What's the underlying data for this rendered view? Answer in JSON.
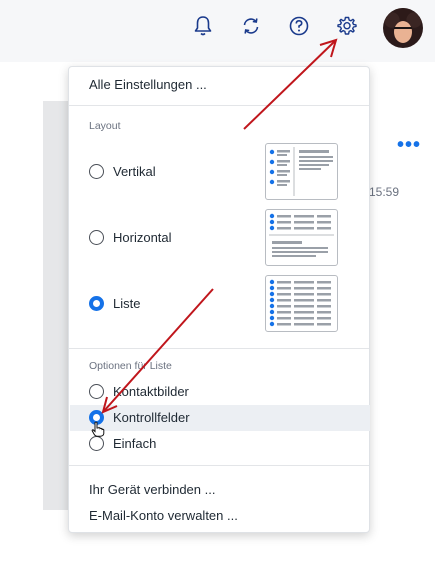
{
  "topbar": {
    "icons": [
      "bell-icon",
      "sync-icon",
      "help-icon",
      "gear-icon"
    ],
    "avatar": "avatar"
  },
  "background": {
    "more_dots": "•••",
    "time": "15:59"
  },
  "menu": {
    "all_settings": "Alle Einstellungen ...",
    "layout_section": "Layout",
    "layout_options": [
      {
        "label": "Vertikal",
        "checked": false
      },
      {
        "label": "Horizontal",
        "checked": false
      },
      {
        "label": "Liste",
        "checked": true
      }
    ],
    "list_options_section": "Optionen für Liste",
    "list_options": [
      {
        "label": "Kontaktbilder",
        "checked": false
      },
      {
        "label": "Kontrollfelder",
        "checked": true
      },
      {
        "label": "Einfach",
        "checked": false
      }
    ],
    "connect_device": "Ihr Gerät verbinden ...",
    "manage_accounts": "E-Mail-Konto verwalten ..."
  },
  "colors": {
    "accent": "#1572e8",
    "icon": "#1a3a8c",
    "annotation_arrow": "#c0161c"
  }
}
